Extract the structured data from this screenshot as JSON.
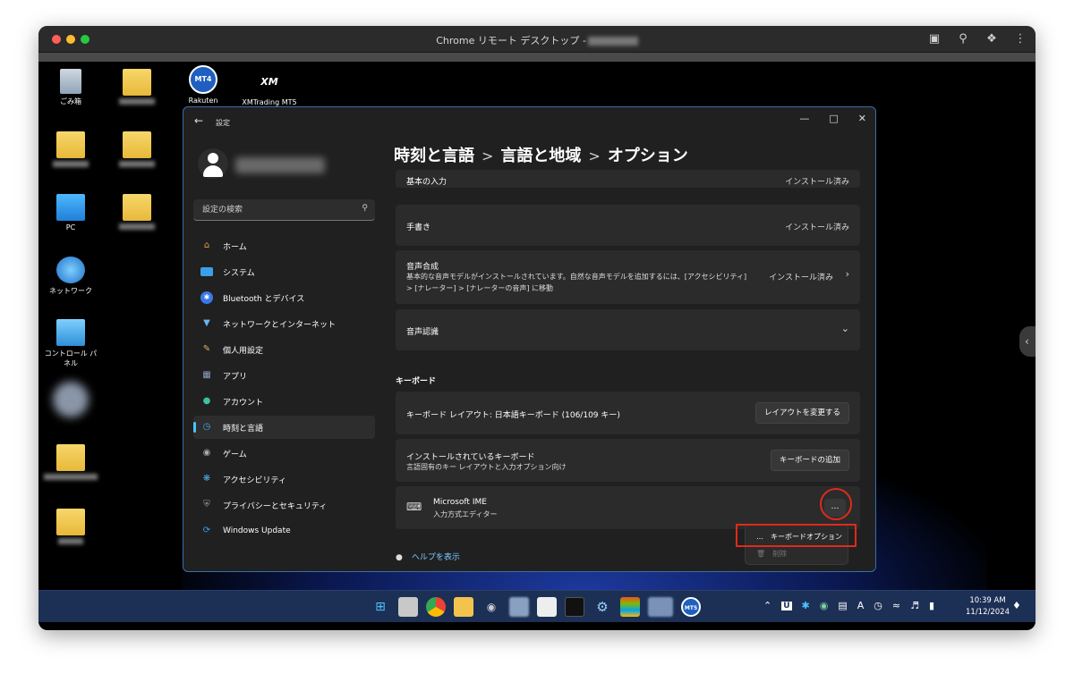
{
  "mac": {
    "title": "Chrome リモート デスクトップ -"
  },
  "desktop": {
    "icons": [
      {
        "label": "ごみ箱",
        "icon": "recycle-bin"
      },
      {
        "label": "Rakuten",
        "icon": "mt4-shortcut"
      },
      {
        "label": "XMTrading MT5",
        "icon": "xm-shortcut"
      },
      {
        "label": "PC",
        "icon": "pc"
      },
      {
        "label": "ネットワーク",
        "icon": "network"
      },
      {
        "label": "コントロール パネル",
        "icon": "control-panel"
      }
    ]
  },
  "settings": {
    "app_title": "設定",
    "search_placeholder": "設定の検索",
    "breadcrumb": [
      "時刻と言語",
      "言語と地域",
      "オプション"
    ],
    "nav": [
      {
        "label": "ホーム",
        "icon": "home-icon",
        "color": "#e8a23a"
      },
      {
        "label": "システム",
        "icon": "system-icon",
        "color": "#3aa0e8"
      },
      {
        "label": "Bluetooth とデバイス",
        "icon": "bluetooth-icon",
        "color": "#3a78e8"
      },
      {
        "label": "ネットワークとインターネット",
        "icon": "wifi-icon",
        "color": "#6ab4f0"
      },
      {
        "label": "個人用設定",
        "icon": "brush-icon",
        "color": "#e0b060"
      },
      {
        "label": "アプリ",
        "icon": "apps-icon",
        "color": "#8aa0c0"
      },
      {
        "label": "アカウント",
        "icon": "account-icon",
        "color": "#3cc0a0"
      },
      {
        "label": "時刻と言語",
        "icon": "clock-globe-icon",
        "color": "#4aa8e8"
      },
      {
        "label": "ゲーム",
        "icon": "game-icon",
        "color": "#aaaaaa"
      },
      {
        "label": "アクセシビリティ",
        "icon": "accessibility-icon",
        "color": "#4ab0f0"
      },
      {
        "label": "プライバシーとセキュリティ",
        "icon": "shield-icon",
        "color": "#9a9a9a"
      },
      {
        "label": "Windows Update",
        "icon": "update-icon",
        "color": "#3a9ee8"
      }
    ],
    "active_nav_index": 7,
    "cards": {
      "basic_input": {
        "label": "基本の入力",
        "status": "インストール済み"
      },
      "handwriting": {
        "label": "手書き",
        "status": "インストール済み"
      },
      "tts": {
        "label": "音声合成",
        "desc1": "基本的な音声モデルがインストールされています。自然な音声モデルを追加するには、[アクセシビリティ]",
        "desc2": "> [ナレーター] > [ナレーターの音声] に移動",
        "status": "インストール済み"
      },
      "speech_recognition": {
        "label": "音声認識"
      }
    },
    "keyboard_heading": "キーボード",
    "keyboard_layout": {
      "label": "キーボード レイアウト: 日本語キーボード (106/109 キー)",
      "button": "レイアウトを変更する"
    },
    "installed_keyboards": {
      "label": "インストールされているキーボード",
      "desc": "言語固有のキー レイアウトと入力オプション向け",
      "button": "キーボードの追加"
    },
    "ime": {
      "name": "Microsoft IME",
      "desc": "入力方式エディター",
      "more": "…"
    },
    "context_menu": {
      "keyboard_options": "キーボードオプション",
      "remove": "削除",
      "dots": "…"
    },
    "help_link": "ヘルプを表示"
  },
  "taskbar": {
    "time": "10:39 AM",
    "date": "11/12/2024"
  },
  "colors": {
    "accent": "#4cc2ff",
    "annotation_red": "#e02a1a",
    "taskbar": "#1c2f55"
  }
}
